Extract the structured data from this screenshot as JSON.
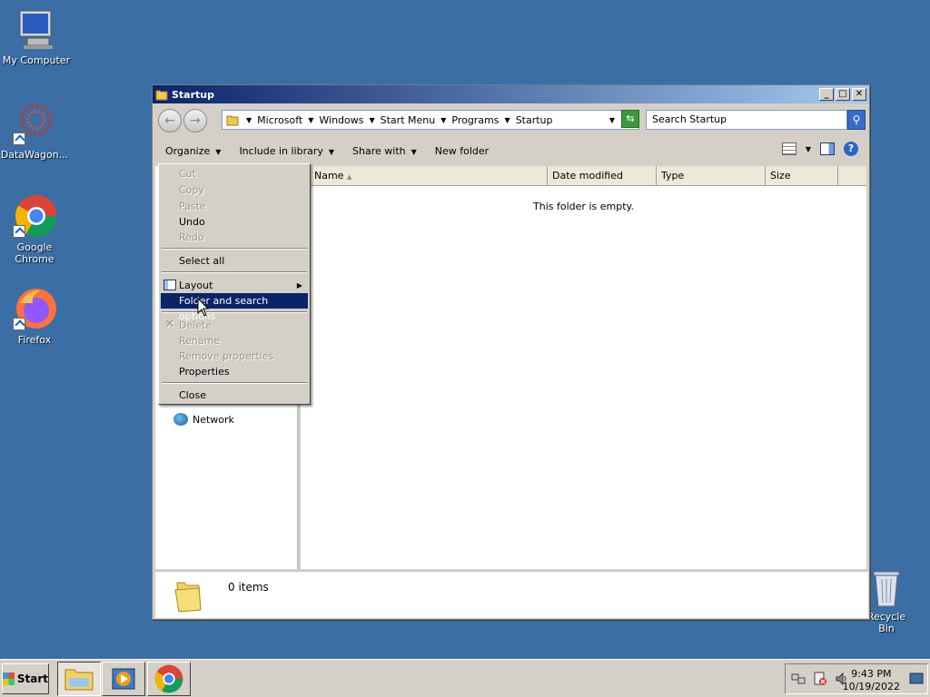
{
  "desktop": {
    "icons": [
      {
        "label": "My Computer"
      },
      {
        "label": "DataWagon..."
      },
      {
        "label": "Google Chrome"
      },
      {
        "label": "Firefox"
      }
    ],
    "recycle_bin": "Recycle Bin"
  },
  "window": {
    "title": "Startup",
    "buttons": {
      "minimize": "_",
      "maximize": "□",
      "close": "✕"
    },
    "breadcrumb": [
      "Microsoft",
      "Windows",
      "Start Menu",
      "Programs",
      "Startup"
    ],
    "search_placeholder": "Search Startup",
    "toolbar": {
      "organize": "Organize",
      "include": "Include in library",
      "share": "Share with",
      "new_folder": "New folder"
    },
    "columns": [
      "Name",
      "Date modified",
      "Type",
      "Size"
    ],
    "empty_text": "This folder is empty.",
    "nav": {
      "network": "Network"
    },
    "status": "0 items"
  },
  "context_menu": {
    "items": [
      {
        "label": "Cut",
        "disabled": true
      },
      {
        "label": "Copy",
        "disabled": true
      },
      {
        "label": "Paste",
        "disabled": true
      },
      {
        "label": "Undo",
        "disabled": false
      },
      {
        "label": "Redo",
        "disabled": true
      },
      {
        "label": "Select all",
        "disabled": false
      },
      {
        "label": "Layout",
        "disabled": false
      },
      {
        "label": "Folder and search options",
        "disabled": false
      },
      {
        "label": "Delete",
        "disabled": true
      },
      {
        "label": "Rename",
        "disabled": true
      },
      {
        "label": "Remove properties",
        "disabled": true
      },
      {
        "label": "Properties",
        "disabled": false
      },
      {
        "label": "Close",
        "disabled": false
      }
    ]
  },
  "taskbar": {
    "start": "Start",
    "time": "9:43 PM",
    "date": "10/19/2022"
  },
  "colors": {
    "desktop": "#3a6ea5",
    "title_active": "#0a246a",
    "highlight": "#0a246a"
  }
}
